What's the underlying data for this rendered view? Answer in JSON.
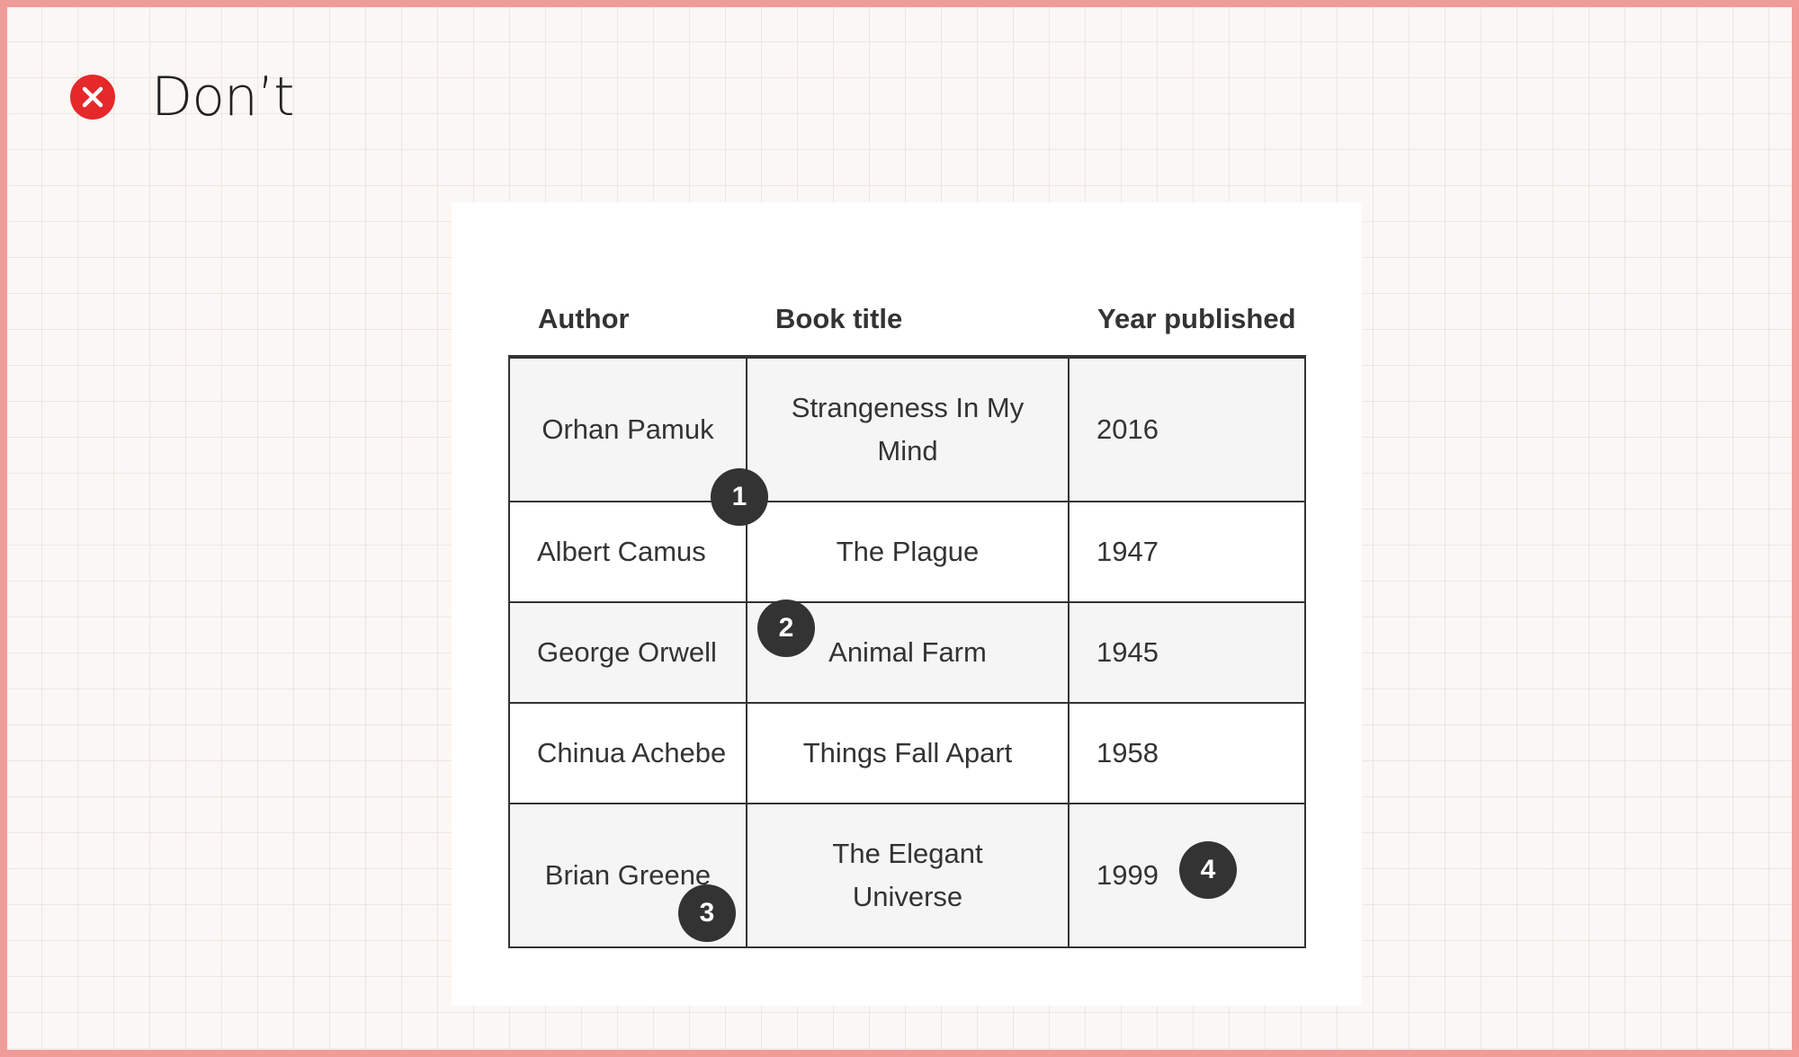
{
  "header": {
    "icon": "close-circle-icon",
    "icon_color": "#e5292b",
    "title": "Don’t"
  },
  "table": {
    "columns": [
      "Author",
      "Book title",
      "Year published"
    ],
    "rows": [
      {
        "author": "Orhan Pamuk",
        "title": "Strangeness In My Mind",
        "year": "2016"
      },
      {
        "author": "Albert Camus",
        "title": "The Plague",
        "year": "1947"
      },
      {
        "author": "George Orwell",
        "title": "Animal Farm",
        "year": "1945"
      },
      {
        "author": "Chinua Achebe",
        "title": "Things Fall Apart",
        "year": "1958"
      },
      {
        "author": "Brian Greene",
        "title": "The Elegant Universe",
        "year": "1999"
      }
    ]
  },
  "badges": [
    "1",
    "2",
    "3",
    "4"
  ],
  "colors": {
    "frame_border": "#f19b99",
    "background": "#faf7f5",
    "badge": "#333333",
    "shaded_row": "#f5f5f5",
    "icon": "#e5292b"
  }
}
